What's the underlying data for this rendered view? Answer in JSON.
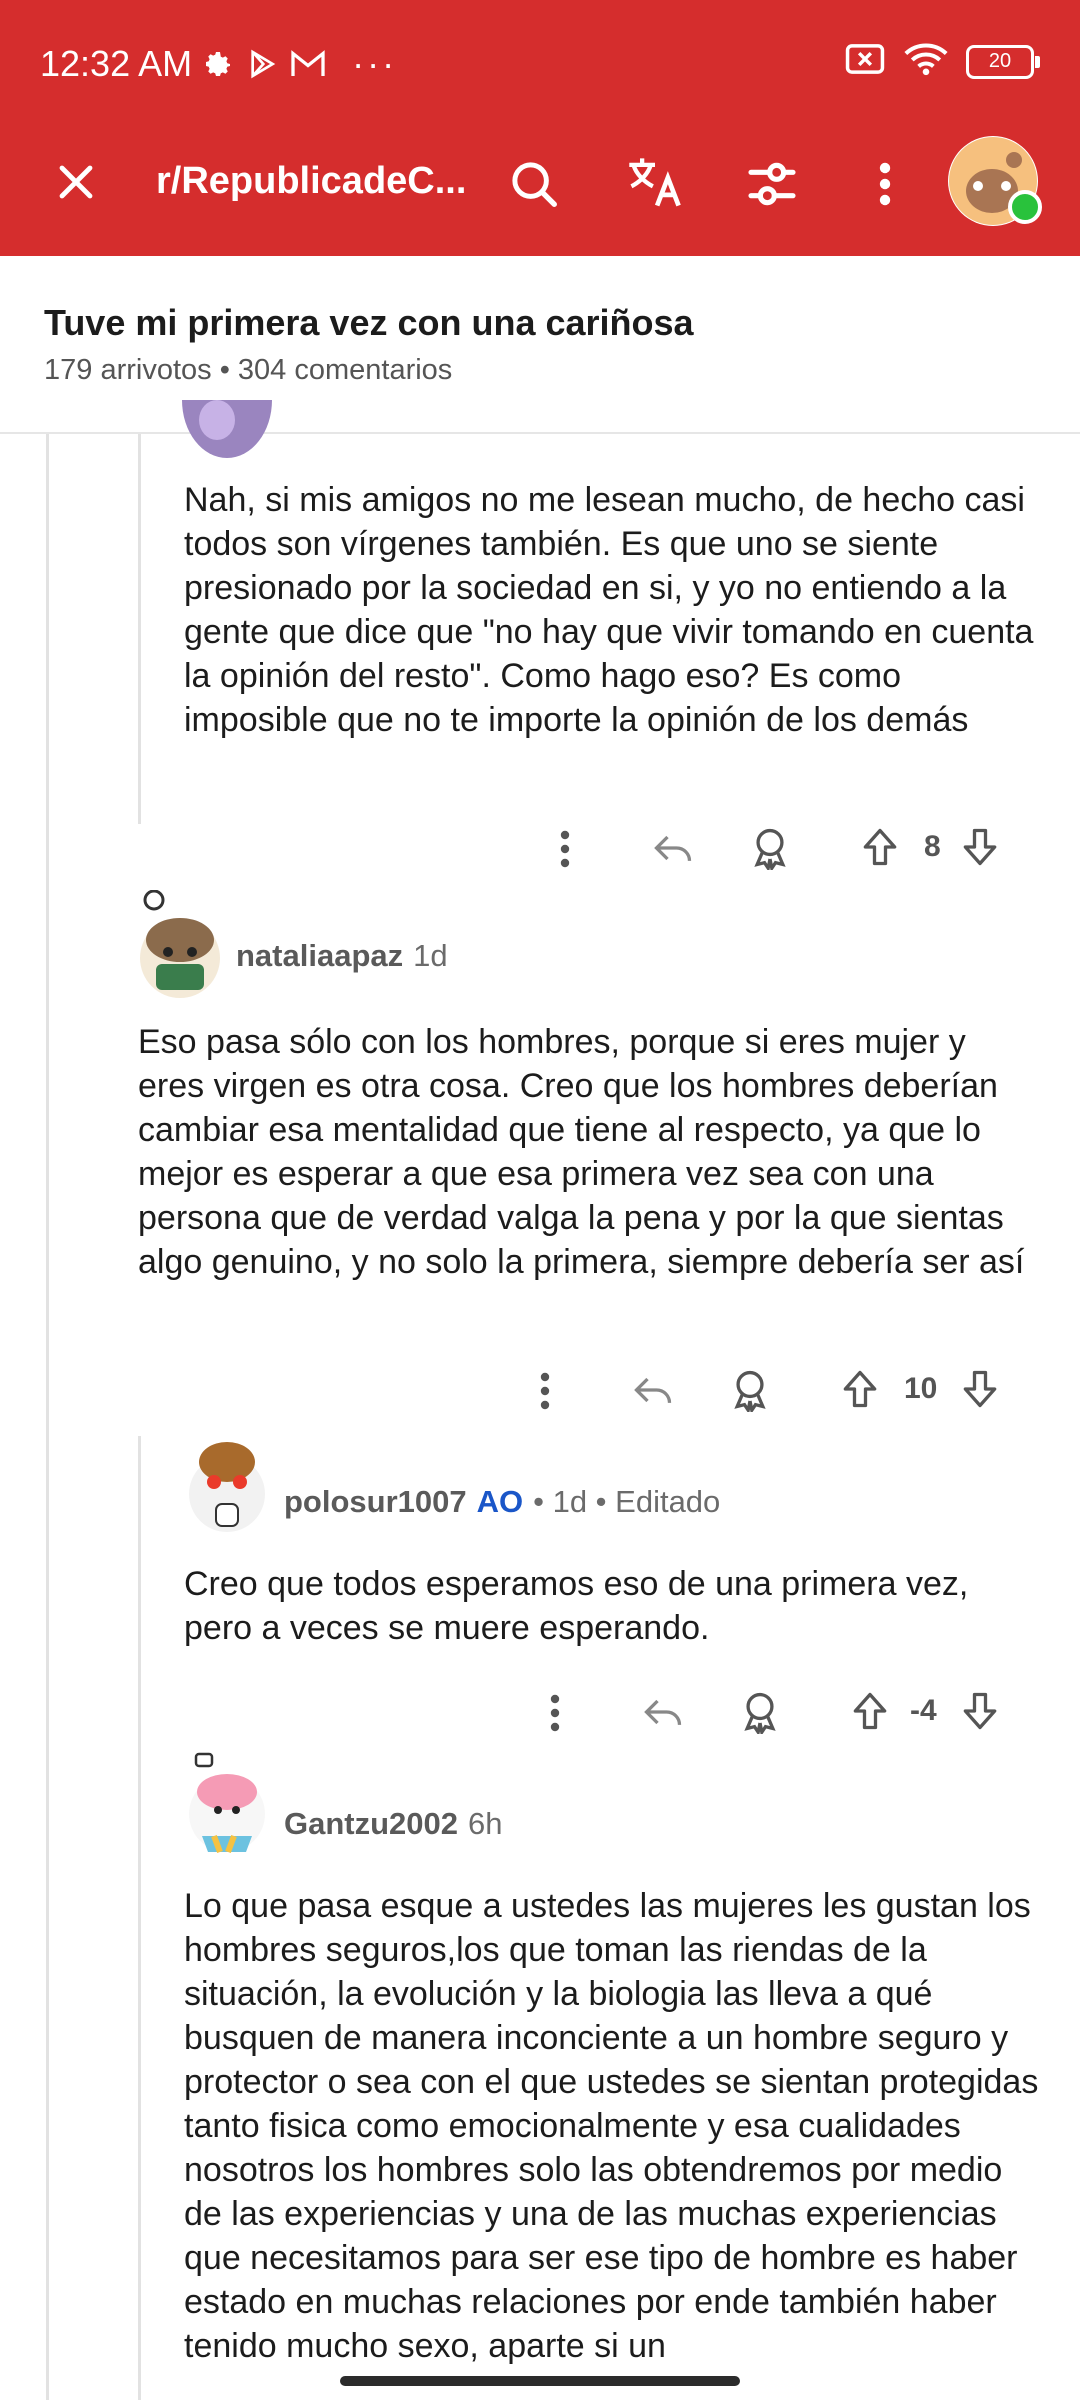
{
  "status_bar": {
    "time": "12:32 AM",
    "battery": "20",
    "more": "···"
  },
  "nav": {
    "subreddit": "r/RepublicadeC..."
  },
  "post": {
    "title": "Tuve mi primera vez con una cariñosa",
    "meta": "179 arrivotos  •  304 comentarios"
  },
  "comments": [
    {
      "text": "Nah, si mis amigos no me lesean mucho, de hecho casi todos son vírgenes también. Es que uno se siente presionado por la sociedad en si, y yo no entiendo a la gente que dice que \"no hay que vivir tomando en cuenta la opinión del resto\". Como hago eso? Es como imposible que no te importe la opinión de los demás",
      "votes": "8"
    },
    {
      "author": "nataliaapaz",
      "time": "1d",
      "text": "Eso pasa sólo con los hombres, porque si eres mujer y eres virgen es otra cosa. Creo que los hombres deberían cambiar esa mentalidad que tiene al respecto, ya que lo mejor es esperar a que esa primera vez sea con una persona que de verdad valga la pena y por la que sientas algo genuino, y no solo la primera, siempre debería ser así",
      "votes": "10"
    },
    {
      "author": "polosur1007",
      "op": "AO",
      "time": "• 1d • Editado",
      "text": "Creo que todos esperamos eso de una primera vez, pero a veces se muere esperando.",
      "votes": "-4"
    },
    {
      "author": "Gantzu2002",
      "time": "6h",
      "text": "Lo que pasa esque a ustedes las mujeres les gustan los hombres seguros,los que toman las riendas de la situación, la evolución y la biologia las lleva a qué busquen de manera inconciente a un hombre seguro y protector o sea con el que ustedes se sientan protegidas tanto fisica como emocionalmente y esa cualidades nosotros los hombres solo las obtendremos por medio de las experiencias y una de las muchas experiencias que necesitamos para ser ese tipo de hombre es haber estado en muchas relaciones por ende también haber tenido mucho sexo, aparte si un"
    }
  ],
  "colors": {
    "brand": "#d52d2d",
    "op_label": "#1a56c8"
  },
  "icons": [
    "close-icon",
    "search-icon",
    "translate-icon",
    "filter-icon",
    "more-vert-icon",
    "settings-icon",
    "play-icon",
    "mail-icon",
    "wifi-icon",
    "sim-icon",
    "reply-icon",
    "award-icon",
    "upvote-icon",
    "downvote-icon"
  ]
}
